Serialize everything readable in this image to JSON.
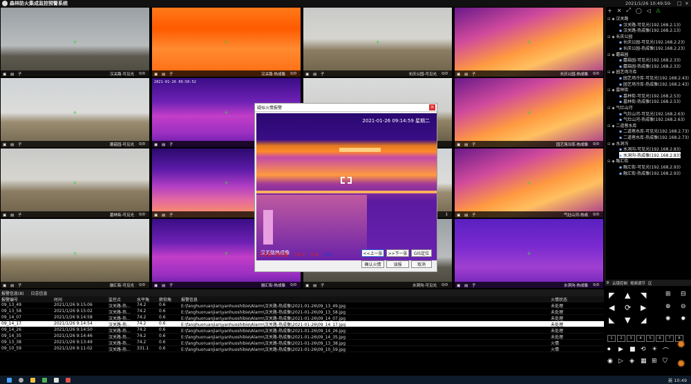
{
  "window": {
    "title": "森林防火集成监控预警系统",
    "clock": "2021/1/26 10:49:50",
    "controls": [
      "–",
      "□",
      "×"
    ]
  },
  "cameras": [
    {
      "label": "汉关路-可见光",
      "count": "0/0",
      "type": "visible-1"
    },
    {
      "label": "汉关路-热成像",
      "count": "0/0",
      "type": "thermal-1"
    },
    {
      "label": "长庆公园-可见光",
      "count": "0/0",
      "type": "visible-2"
    },
    {
      "label": "长庆公园-热成像",
      "count": "0/0",
      "type": "thermal-4"
    },
    {
      "label": "蘑菇园-可见光",
      "count": "0/0",
      "type": "visible-3"
    },
    {
      "label": "",
      "count": "",
      "type": "thermal-3",
      "osd": "2021-01-26 09:50:52"
    },
    {
      "label": "",
      "count": "",
      "type": "visible-4"
    },
    {
      "label": "园艺场冷库-热成像",
      "count": "0/0",
      "type": "thermal-4"
    },
    {
      "label": "墓林街-可见光",
      "count": "0/0",
      "type": "visible-2"
    },
    {
      "label": "墓林",
      "count": "",
      "type": "thermal-2"
    },
    {
      "label": "",
      "count": "1",
      "type": "visible-3"
    },
    {
      "label": "气灶山河-热成",
      "count": "0/0",
      "type": "thermal-4"
    },
    {
      "label": "融汇街-可见光",
      "count": "0/0",
      "type": "visible-4"
    },
    {
      "label": "融汇街-热成像",
      "count": "0/0",
      "type": "thermal-3"
    },
    {
      "label": "水洞沟-可见光",
      "count": "0/0",
      "type": "visible-1"
    },
    {
      "label": "水洞沟-热成像",
      "count": "0/0",
      "type": "thermal-5"
    }
  ],
  "cell_tools": "▣ ▤ 子",
  "popup": {
    "title": "疑似火情报警",
    "close": "×",
    "timestamp": "2021-01-26 09:14:59 星期二",
    "image_label": "汉关路热成像",
    "info_name": "汉关路-热成像",
    "info_value1": "74.2",
    "info_value2": "0.6",
    "info_page": "4/8",
    "buttons": {
      "prev": "<<上一张",
      "next": ">>下一张",
      "gis": "GIS定位",
      "confirm": "确认火情",
      "false_alarm": "误报",
      "cancel": "取消"
    }
  },
  "tree": {
    "toolbar": [
      "+",
      "✕",
      "⤢",
      "◯",
      "◁",
      "⚠"
    ],
    "nodes": [
      {
        "text": "汉关路",
        "kind": "grp"
      },
      {
        "text": "汉关路-可见光(192.168.2.13)",
        "kind": "leaf"
      },
      {
        "text": "汉关路-热成像(192.168.2.13)",
        "kind": "leaf"
      },
      {
        "text": "长庆公园",
        "kind": "grp"
      },
      {
        "text": "长庆公园-可见光(192.168.2.23)",
        "kind": "leaf"
      },
      {
        "text": "长庆公园-热成像(192.168.2.23)",
        "kind": "leaf"
      },
      {
        "text": "蘑菇园",
        "kind": "grp"
      },
      {
        "text": "蘑菇园-可见光(192.168.2.33)",
        "kind": "leaf"
      },
      {
        "text": "蘑菇园-热成像(192.168.2.33)",
        "kind": "leaf"
      },
      {
        "text": "园艺场冷库",
        "kind": "grp"
      },
      {
        "text": "园艺场冷库-可见光(192.168.2.43)",
        "kind": "leaf"
      },
      {
        "text": "园艺场冷库-热成像(192.168.2.43)",
        "kind": "leaf"
      },
      {
        "text": "墓林街",
        "kind": "grp"
      },
      {
        "text": "墓林街-可见光(192.168.2.53)",
        "kind": "leaf"
      },
      {
        "text": "墓林街-热成像(192.168.2.53)",
        "kind": "leaf"
      },
      {
        "text": "气灶山河",
        "kind": "grp"
      },
      {
        "text": "气灶山河-可见光(192.168.2.63)",
        "kind": "leaf"
      },
      {
        "text": "气灶山河-热成像(192.168.2.63)",
        "kind": "leaf"
      },
      {
        "text": "二道巷水库",
        "kind": "grp"
      },
      {
        "text": "二道巷水库-可见光(192.168.2.73)",
        "kind": "leaf"
      },
      {
        "text": "二道巷水库-热成像(192.168.2.73)",
        "kind": "leaf"
      },
      {
        "text": "水洞沟",
        "kind": "grp"
      },
      {
        "text": "水洞沟-可见光(192.168.2.83)",
        "kind": "leaf"
      },
      {
        "text": "水洞沟-热成像(192.168.2.83)",
        "kind": "leaf-hl"
      },
      {
        "text": "融汇街",
        "kind": "grp"
      },
      {
        "text": "融汇街-可见光(192.168.2.93)",
        "kind": "leaf"
      },
      {
        "text": "融汇街-热成像(192.168.2.93)",
        "kind": "leaf"
      }
    ]
  },
  "alarms": {
    "tabs": [
      "报警信息(8)",
      "日志信息"
    ],
    "headers": [
      "报警编号",
      "时间",
      "监控点",
      "水平角",
      "俯仰角",
      "报警信息",
      "火情状态"
    ],
    "rows": [
      {
        "id": "09_13_49",
        "time": "2021/1/26 9:15:06",
        "site": "汉关路-热...",
        "h": "74.2",
        "v": "0.6",
        "path": "E:\\fanghuoruanjian\\yanhuoshibie\\Alarm\\汉关路-热成像\\2021-01-26\\09_13_49.jpg",
        "status": "未处理"
      },
      {
        "id": "09_13_58",
        "time": "2021/1/26 9:15:02",
        "site": "汉关路-热...",
        "h": "74.2",
        "v": "0.6",
        "path": "E:\\fanghuoruanjian\\yanhuoshibie\\Alarm\\汉关路-热成像\\2021-01-26\\09_13_58.jpg",
        "status": "未处理"
      },
      {
        "id": "09_14_07",
        "time": "2021/1/26 9:14:58",
        "site": "汉关路-热...",
        "h": "74.2",
        "v": "0.6",
        "path": "E:\\fanghuoruanjian\\yanhuoshibie\\Alarm\\汉关路-热成像\\2021-01-26\\09_14_07.jpg",
        "status": "未处理"
      },
      {
        "id": "09_14_17",
        "time": "2021/1/26 9:14:54",
        "site": "汉关路-热...",
        "h": "74.2",
        "v": "0.6",
        "path": "E:\\fanghuoruanjian\\yanhuoshibie\\Alarm\\汉关路-热成像\\2021-01-26\\09_14_17.jpg",
        "status": "未处理"
      },
      {
        "id": "09_14_26",
        "time": "2021/1/26 9:14:50",
        "site": "汉关路-热...",
        "h": "74.2",
        "v": "0.6",
        "path": "E:\\fanghuoruanjian\\yanhuoshibie\\Alarm\\汉关路-热成像\\2021-01-26\\09_14_26.jpg",
        "status": "未处理"
      },
      {
        "id": "09_14_35",
        "time": "2021/1/26 9:14:46",
        "site": "汉关路-热...",
        "h": "74.2",
        "v": "0.6",
        "path": "E:\\fanghuoruanjian\\yanhuoshibie\\Alarm\\汉关路-热成像\\2021-01-26\\09_14_35.jpg",
        "status": "未处理"
      },
      {
        "id": "09_13_38",
        "time": "2021/1/26 9:13:49",
        "site": "汉关路-热...",
        "h": "74.2",
        "v": "0.6",
        "path": "E:\\fanghuoruanjian\\yanhuoshibie\\Alarm\\汉关路-热成像\\2021-01-26\\09_13_38.jpg",
        "status": "火情"
      },
      {
        "id": "09_10_59",
        "time": "2021/1/26 9:11:02",
        "site": "汉关路-热...",
        "h": "331.1",
        "v": "0.6",
        "path": "E:\\fanghuoruanjian\\yanhuoshibie\\Alarm\\汉关路-热成像\\2021-01-26\\09_10_59.jpg",
        "status": "火情"
      }
    ],
    "selected_index": 3
  },
  "ptz": {
    "tabs": [
      "云镜控制",
      "视频调节",
      "区"
    ],
    "presets": [
      "1",
      "2",
      "3",
      "4",
      "5",
      "6",
      "7",
      "8"
    ]
  },
  "taskbar": {
    "time": "10:49",
    "lang": "英"
  }
}
